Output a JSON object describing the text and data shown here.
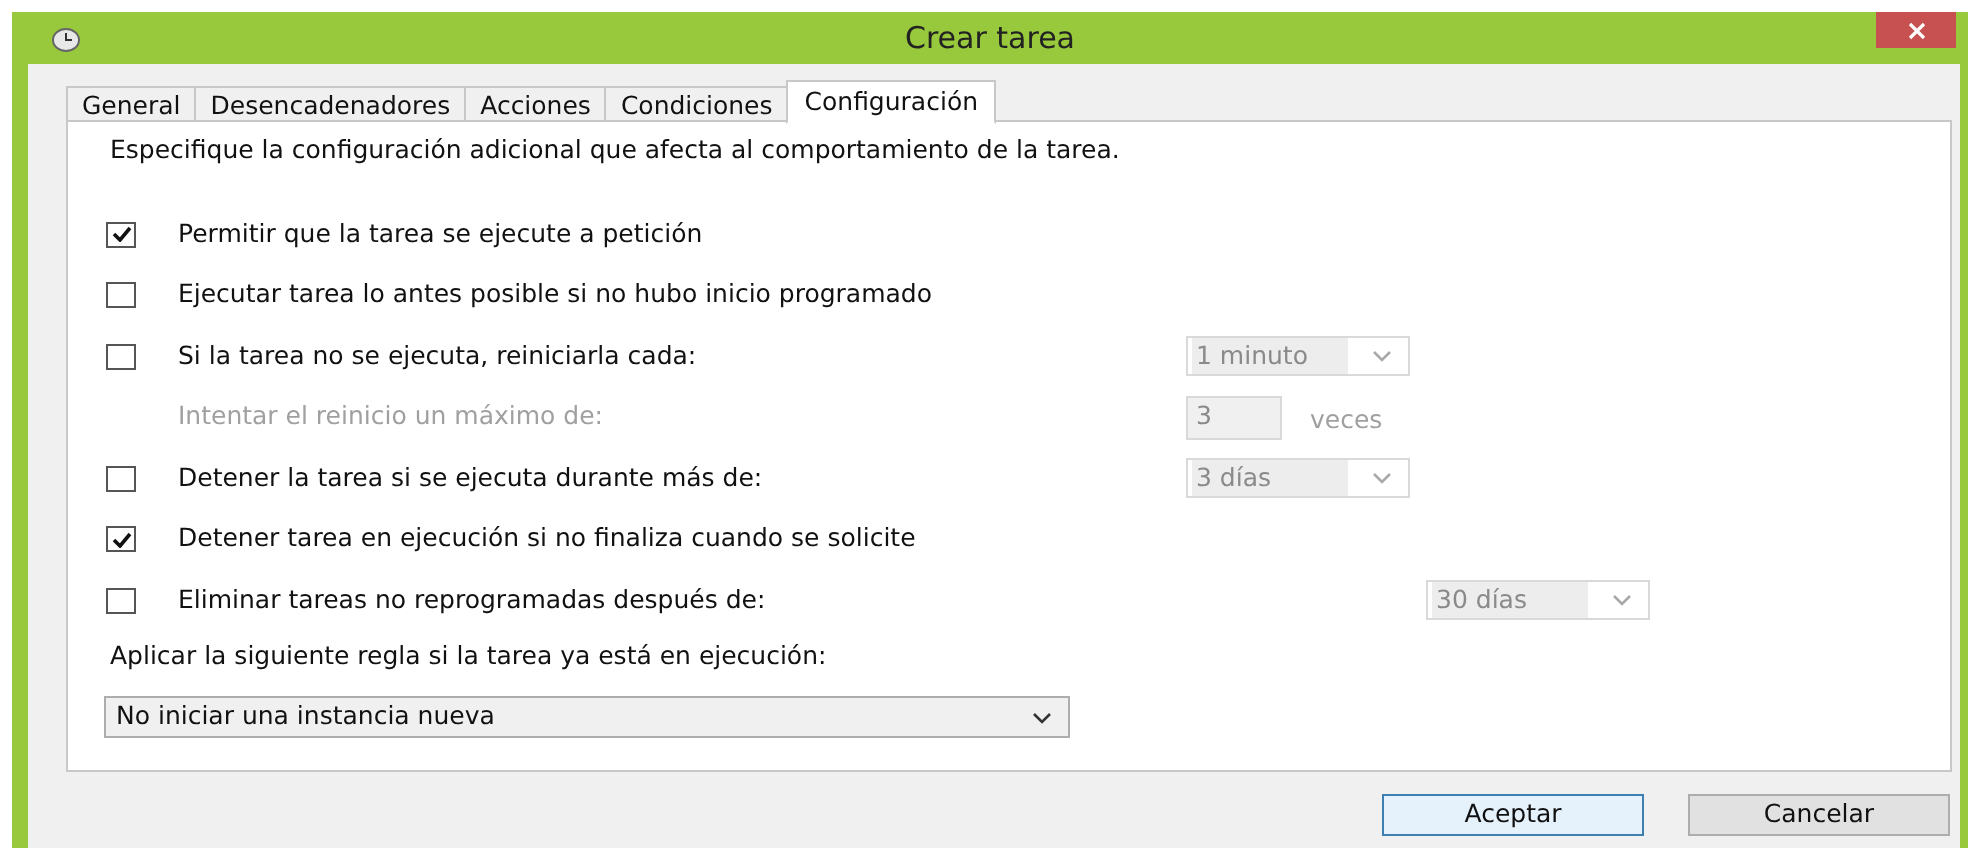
{
  "window": {
    "title": "Crear tarea"
  },
  "tabs": [
    {
      "label": "General",
      "selected": false
    },
    {
      "label": "Desencadenadores",
      "selected": false
    },
    {
      "label": "Acciones",
      "selected": false
    },
    {
      "label": "Condiciones",
      "selected": false
    },
    {
      "label": "Configuración",
      "selected": true
    }
  ],
  "description": "Especifique la configuración adicional que afecta al comportamiento de la tarea.",
  "settings": [
    {
      "kind": "checkbox",
      "label": "Permitir que la tarea se ejecute a petición",
      "checked": true
    },
    {
      "kind": "checkbox",
      "label": "Ejecutar tarea lo antes posible si no hubo inicio programado",
      "checked": false
    },
    {
      "kind": "checkbox",
      "label": "Si la tarea no se ejecuta, reiniciarla cada:",
      "checked": false,
      "control": {
        "kind": "select",
        "value": "1 minuto",
        "disabled": true
      }
    },
    {
      "kind": "indented",
      "label": "Intentar el reinicio un máximo de:",
      "disabled": true,
      "control": {
        "kind": "number",
        "value": "3",
        "unit": "veces",
        "disabled": true
      }
    },
    {
      "kind": "checkbox",
      "label": "Detener la tarea si se ejecuta durante más de:",
      "checked": false,
      "control": {
        "kind": "select",
        "value": "3 días",
        "disabled": true
      }
    },
    {
      "kind": "checkbox",
      "label": "Detener tarea en ejecución si no finaliza cuando se solicite",
      "checked": true
    },
    {
      "kind": "checkbox",
      "label": "Eliminar tareas no reprogramadas después de:",
      "checked": false,
      "wide": true,
      "control": {
        "kind": "select",
        "value": "30 días",
        "disabled": true
      }
    }
  ],
  "rule": {
    "label": "Aplicar la siguiente regla si la tarea ya está en ejecución:",
    "value": "No iniciar una instancia nueva"
  },
  "buttons": [
    {
      "label": "Aceptar",
      "default": true
    },
    {
      "label": "Cancelar",
      "default": false
    }
  ]
}
